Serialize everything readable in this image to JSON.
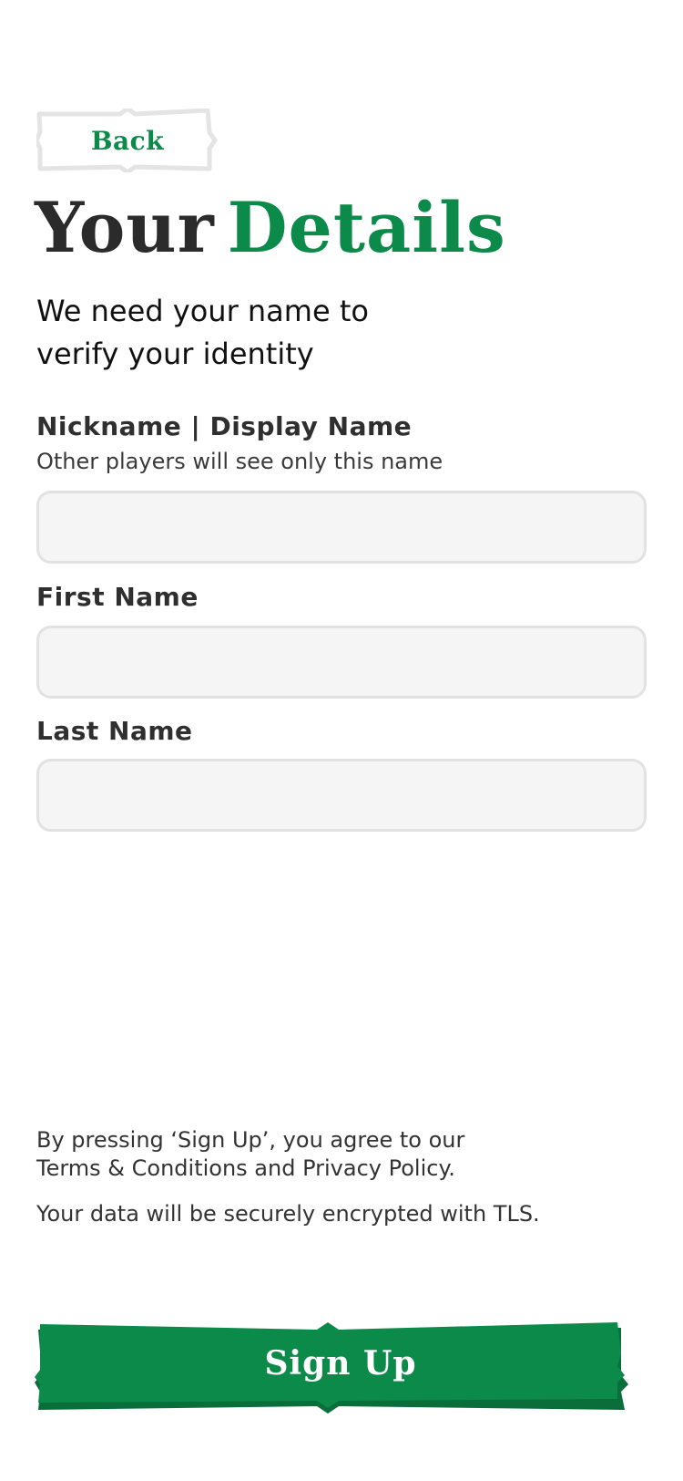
{
  "header": {
    "back_label": "Back"
  },
  "title": {
    "part1": "Your",
    "part2": "Details"
  },
  "subtitle": "We need your name to verify your identity",
  "form": {
    "nickname": {
      "label": "Nickname | Display Name",
      "hint": "Other players will see only this name",
      "value": "",
      "placeholder": ""
    },
    "first_name": {
      "label": "First Name",
      "value": "",
      "placeholder": ""
    },
    "last_name": {
      "label": "Last Name",
      "value": "",
      "placeholder": ""
    }
  },
  "footer": {
    "legal_line1": "By pressing ‘Sign Up’, you agree to our",
    "legal_line2": "Terms & Conditions and Privacy Policy.",
    "security_note": "Your data will be securely encrypted with TLS.",
    "signup_label": "Sign Up"
  },
  "colors": {
    "accent": "#0c8a4a",
    "accent_dark": "#0a6e3b",
    "field_bg": "#f5f5f5",
    "field_border": "#e2e2e2",
    "title_dark": "#2b2b2b"
  }
}
